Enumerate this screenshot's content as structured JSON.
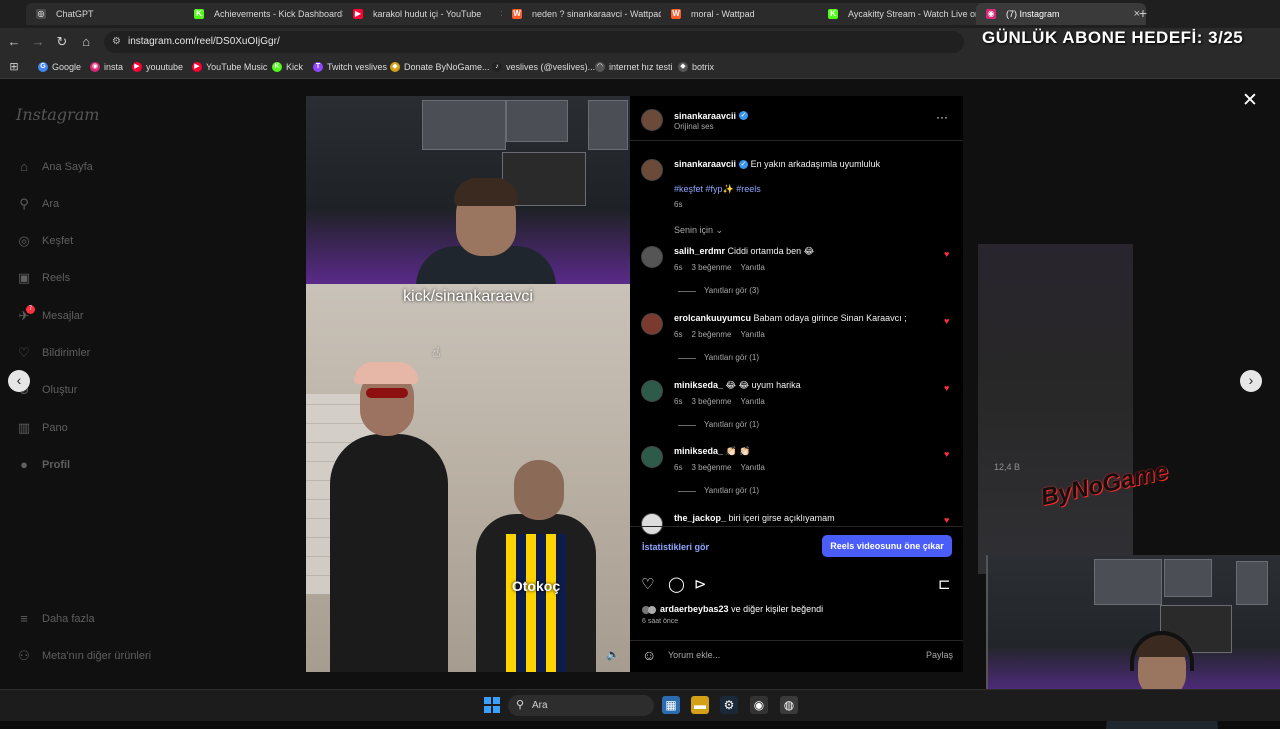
{
  "browser": {
    "tabs": [
      {
        "title": "ChatGPT",
        "icon": "chatgpt-icon",
        "color": "#4a4a4a",
        "glyph": "◎"
      },
      {
        "title": "Achievements - Kick Dashboard",
        "icon": "kick-icon",
        "color": "#53fc18",
        "glyph": "K"
      },
      {
        "title": "karakol hudut içi - YouTube",
        "icon": "youtube-icon",
        "color": "#ff0033",
        "glyph": "▶"
      },
      {
        "title": "neden ? sinankaraavci - Wattpad",
        "icon": "wattpad-icon",
        "color": "#ff5c2b",
        "glyph": "W"
      },
      {
        "title": "moral - Wattpad",
        "icon": "wattpad-icon",
        "color": "#ff5c2b",
        "glyph": "W"
      },
      {
        "title": "Aycakitty Stream - Watch Live on Kick",
        "icon": "kick-icon",
        "color": "#53fc18",
        "glyph": "K"
      },
      {
        "title": "(7) Instagram",
        "icon": "instagram-icon",
        "color": "#d62976",
        "glyph": "◉"
      }
    ],
    "url": "instagram.com/reel/DS0XuOIjGgr/",
    "bookmarks": [
      {
        "label": "Google",
        "icon": "google-icon",
        "color": "#4285f4",
        "glyph": "G"
      },
      {
        "label": "insta",
        "icon": "instagram-icon",
        "color": "#d62976",
        "glyph": "◉"
      },
      {
        "label": "youutube",
        "icon": "youtube-icon",
        "color": "#ff0033",
        "glyph": "▶"
      },
      {
        "label": "YouTube Music",
        "icon": "youtube-music-icon",
        "color": "#ff0033",
        "glyph": "▶"
      },
      {
        "label": "Kick",
        "icon": "kick-icon",
        "color": "#53fc18",
        "glyph": "K"
      },
      {
        "label": "Twitch veslives",
        "icon": "twitch-icon",
        "color": "#9146ff",
        "glyph": "T"
      },
      {
        "label": "Donate ByNoGame...",
        "icon": "donate-icon",
        "color": "#d4a017",
        "glyph": "◆"
      },
      {
        "label": "veslives (@veslives)...",
        "icon": "tiktok-icon",
        "color": "#222222",
        "glyph": "♪"
      },
      {
        "label": "internet hız testi",
        "icon": "speedtest-icon",
        "color": "#555555",
        "glyph": "◠"
      },
      {
        "label": "botrix",
        "icon": "botrix-icon",
        "color": "#555555",
        "glyph": "◆"
      }
    ]
  },
  "overlay": {
    "sub_goal": "GÜNLÜK ABONE HEDEFİ: 3/25",
    "watermark": "ByNoGame",
    "bg_views": "12,4 B"
  },
  "instagram": {
    "logo": "Instagram",
    "nav": [
      {
        "label": "Ana Sayfa",
        "icon": "home-icon",
        "glyph": "⌂"
      },
      {
        "label": "Ara",
        "icon": "search-icon",
        "glyph": "⚲"
      },
      {
        "label": "Keşfet",
        "icon": "compass-icon",
        "glyph": "◎"
      },
      {
        "label": "Reels",
        "icon": "reels-icon",
        "glyph": "▣"
      },
      {
        "label": "Mesajlar",
        "icon": "messages-icon",
        "glyph": "✈"
      },
      {
        "label": "Bildirimler",
        "icon": "heart-icon",
        "glyph": "♡"
      },
      {
        "label": "Oluştur",
        "icon": "plus-icon",
        "glyph": "⊕"
      },
      {
        "label": "Pano",
        "icon": "dashboard-icon",
        "glyph": "▥"
      },
      {
        "label": "Profil",
        "icon": "profile-icon",
        "glyph": "●"
      }
    ],
    "more": {
      "label": "Daha fazla",
      "icon": "menu-icon",
      "glyph": "≡"
    },
    "meta": {
      "label": "Meta'nın diğer ürünleri",
      "icon": "meta-icon",
      "glyph": "⚇"
    },
    "messages_badge": "7"
  },
  "reel": {
    "video_caption": "kick/sinankaraavci",
    "jersey_text": "Otokoç",
    "author": "sinankaraavcii",
    "audio": "Orijinal ses",
    "caption": "En yakın arkadaşımla uyumluluk",
    "hashtags": "#keşfet #fyp✨ #reels",
    "caption_time": "6s",
    "for_you": "Senin için",
    "comments": [
      {
        "user": "salih_erdmr",
        "text": "Ciddi ortamda ben 😂",
        "time": "6s",
        "likes": "3 beğenme",
        "reply": "Yanıtla",
        "replies": "Yanıtları gör (3)",
        "avatar_color": "#555555"
      },
      {
        "user": "erolcankuuyumcu",
        "text": "Babam odaya girince Sinan Karaavcı ;",
        "time": "6s",
        "likes": "2 beğenme",
        "reply": "Yanıtla",
        "replies": "Yanıtları gör (1)",
        "avatar_color": "#7a3b2e"
      },
      {
        "user": "minikseda_",
        "text": "😂 😂 uyum harika",
        "time": "6s",
        "likes": "3 beğenme",
        "reply": "Yanıtla",
        "replies": "Yanıtları gör (1)",
        "avatar_color": "#2e5a4a"
      },
      {
        "user": "minikseda_",
        "text": "👏🏻 👏🏻",
        "time": "6s",
        "likes": "3 beğenme",
        "reply": "Yanıtla",
        "replies": "Yanıtları gör (1)",
        "avatar_color": "#2e5a4a"
      }
    ],
    "last_comment": {
      "user": "the_jackop_",
      "text": "biri içeri girse açıklıyamam"
    },
    "stats_link": "İstatistikleri gör",
    "boost_button": "Reels videosunu öne çıkar",
    "liked_by_user": "ardaerbeybas23",
    "liked_by_rest": "ve diğer kişiler beğendi",
    "liked_by_others": "diğer kişiler",
    "time_ago": "6 saat önce",
    "comment_placeholder": "Yorum ekle...",
    "share": "Paylaş"
  },
  "taskbar": {
    "search": "Ara",
    "apps": [
      {
        "icon": "photos-icon",
        "color": "#2b6cb0",
        "glyph": "▦"
      },
      {
        "icon": "file-explorer-icon",
        "color": "#d4a017",
        "glyph": "▬"
      },
      {
        "icon": "steam-icon",
        "color": "#1b2838",
        "glyph": "⚙"
      },
      {
        "icon": "recorder-icon",
        "color": "#333333",
        "glyph": "◉"
      },
      {
        "icon": "chrome-icon",
        "color": "#3a3a3a",
        "glyph": "◍"
      }
    ]
  }
}
